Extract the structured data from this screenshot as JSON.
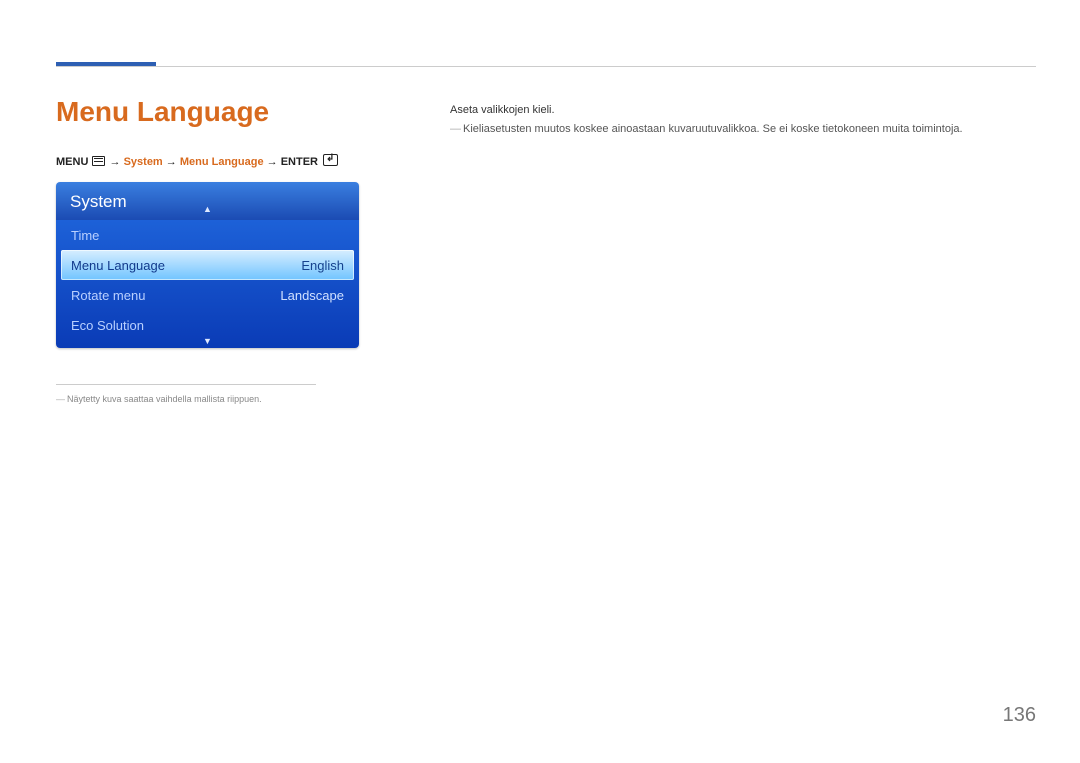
{
  "header": {
    "page_title": "Menu Language"
  },
  "breadcrumb": {
    "prefix": "MENU",
    "arrow": "→",
    "part2": "System",
    "part3": "Menu Language",
    "suffix": "ENTER"
  },
  "osd": {
    "title": "System",
    "rows": [
      {
        "label": "Time",
        "value": "",
        "selected": false
      },
      {
        "label": "Menu Language",
        "value": "English",
        "selected": true
      },
      {
        "label": "Rotate menu",
        "value": "Landscape",
        "selected": false
      },
      {
        "label": "Eco Solution",
        "value": "",
        "selected": false
      }
    ]
  },
  "footnote": "Näytetty kuva saattaa vaihdella mallista riippuen.",
  "right": {
    "line1": "Aseta valikkojen kieli.",
    "line2": "Kieliasetusten muutos koskee ainoastaan kuvaruutuvalikkoa. Se ei koske tietokoneen muita toimintoja."
  },
  "page_number": "136"
}
